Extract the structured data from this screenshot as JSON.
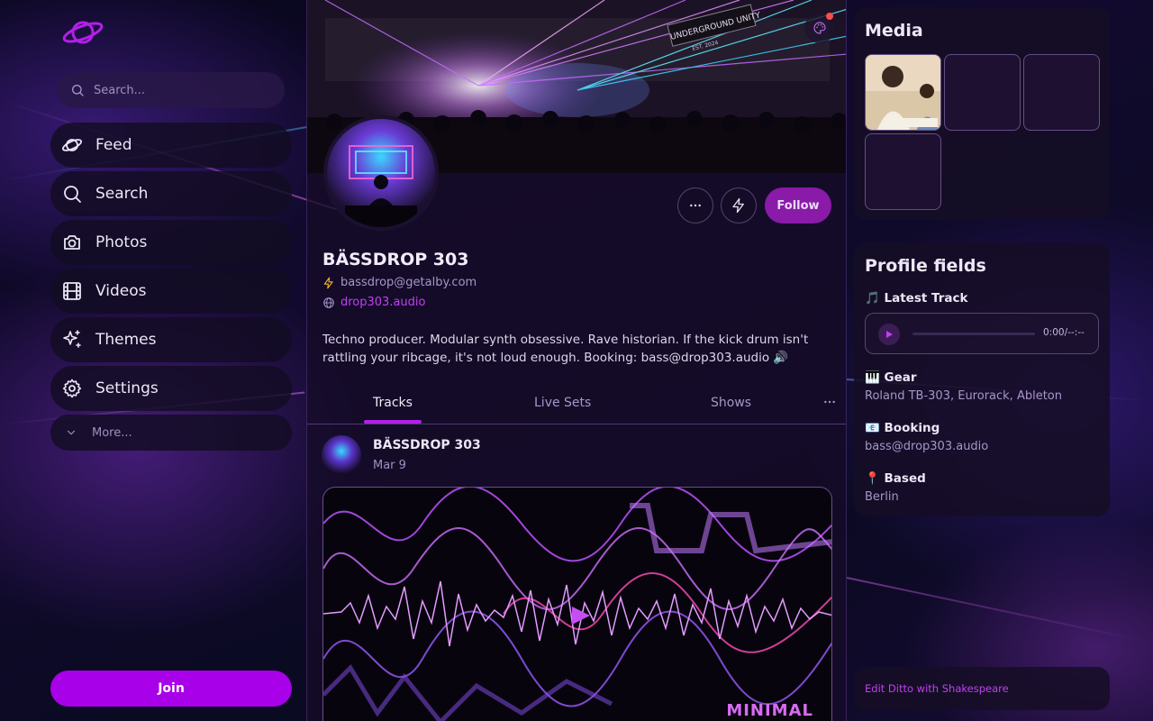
{
  "sidebar": {
    "search_placeholder": "Search...",
    "items": [
      {
        "label": "Feed",
        "icon": "planet-icon"
      },
      {
        "label": "Search",
        "icon": "search-icon"
      },
      {
        "label": "Photos",
        "icon": "camera-icon"
      },
      {
        "label": "Videos",
        "icon": "film-icon"
      },
      {
        "label": "Themes",
        "icon": "sparkles-icon"
      },
      {
        "label": "Settings",
        "icon": "gear-icon"
      }
    ],
    "more_label": "More...",
    "join_label": "Join"
  },
  "profile": {
    "display_name": "BÄSSDROP 303",
    "lightning_address": "bassdrop@getalby.com",
    "website": "drop303.audio",
    "bio": "Techno producer. Modular synth obsessive. Rave historian. If the kick drum isn't rattling your ribcage, it's not loud enough. Booking: bass@drop303.audio 🔊",
    "follow_label": "Follow",
    "banner_sign": "UNDERGROUND UNITY",
    "banner_sign_sub": "EST. 2024"
  },
  "tabs": [
    {
      "label": "Tracks",
      "active": true
    },
    {
      "label": "Live Sets",
      "active": false
    },
    {
      "label": "Shows",
      "active": false
    }
  ],
  "post": {
    "author": "BÄSSDROP 303",
    "date": "Mar 9",
    "media_caption": "MINIMAL"
  },
  "media": {
    "title": "Media"
  },
  "profile_fields": {
    "title": "Profile fields",
    "latest_track_label": "🎵 Latest Track",
    "player_time": "0:00/--:--",
    "gear_label": "🎹 Gear",
    "gear_value": "Roland TB-303, Eurorack, Ableton",
    "booking_label": "📧 Booking",
    "booking_value": "bass@drop303.audio",
    "based_label": "📍 Based",
    "based_value": "Berlin"
  },
  "footer": {
    "link": "Edit Ditto with Shakespeare"
  },
  "colors": {
    "accent": "#a800e8",
    "link": "#c040f0",
    "lightning": "#f0b429",
    "notification": "#ff4b4b"
  }
}
